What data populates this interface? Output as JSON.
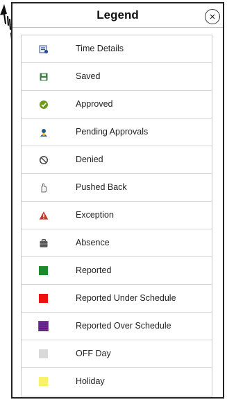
{
  "dialog": {
    "title": "Legend",
    "close_icon": "close-icon",
    "close_glyph": "×"
  },
  "legend": {
    "items": [
      {
        "label": "Time Details",
        "icon": "time-details-icon",
        "color": "#2f4f8f"
      },
      {
        "label": "Saved",
        "icon": "saved-icon",
        "color": "#3a7d44"
      },
      {
        "label": "Approved",
        "icon": "approved-icon",
        "color": "#6a9a1a"
      },
      {
        "label": "Pending Approvals",
        "icon": "pending-approvals-icon",
        "color": "#1f5f8b"
      },
      {
        "label": "Denied",
        "icon": "denied-icon",
        "color": "#444444"
      },
      {
        "label": "Pushed Back",
        "icon": "pushed-back-icon",
        "color": "#666666"
      },
      {
        "label": "Exception",
        "icon": "exception-icon",
        "color": "#c0392b"
      },
      {
        "label": "Absence",
        "icon": "absence-icon",
        "color": "#555555"
      },
      {
        "label": "Reported",
        "icon": "reported-swatch",
        "color": "#1e8a2e"
      },
      {
        "label": "Reported Under Schedule",
        "icon": "reported-under-schedule-swatch",
        "color": "#ee1111"
      },
      {
        "label": "Reported Over Schedule",
        "icon": "reported-over-schedule-swatch",
        "color": "#8e44ad"
      },
      {
        "label": "OFF Day",
        "icon": "off-day-swatch",
        "color": "#d9d9d9"
      },
      {
        "label": "Holiday",
        "icon": "holiday-swatch",
        "color": "#f7f26a"
      }
    ]
  }
}
